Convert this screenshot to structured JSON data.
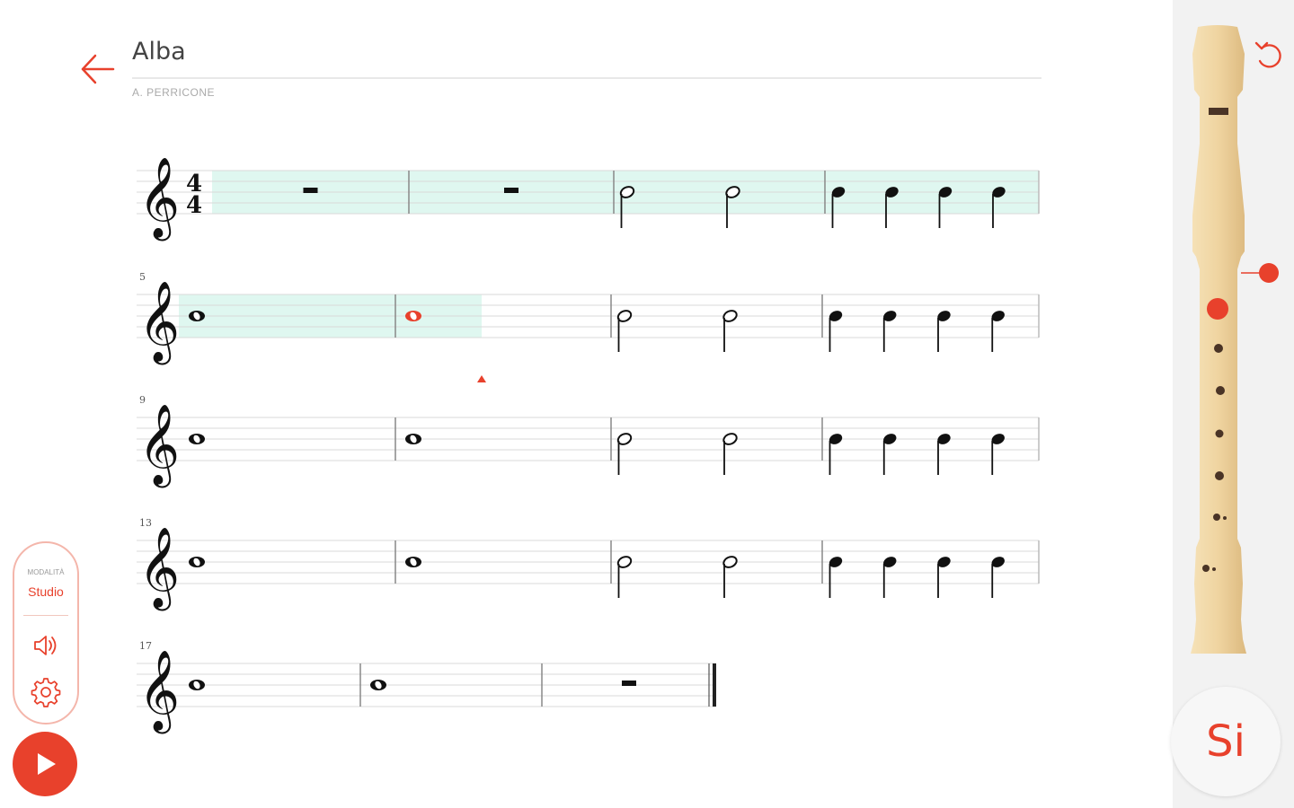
{
  "header": {
    "title": "Alba",
    "composer": "A. PERRICONE"
  },
  "score": {
    "time_signature": {
      "top": "4",
      "bottom": "4"
    },
    "rows": [
      {
        "number": "",
        "measures": [
          {
            "notes": [
              "rest-half"
            ]
          },
          {
            "notes": [
              "rest-half"
            ]
          },
          {
            "notes": [
              "half",
              "half"
            ]
          },
          {
            "notes": [
              "quarter",
              "quarter",
              "quarter",
              "quarter"
            ]
          }
        ]
      },
      {
        "number": "5",
        "measures": [
          {
            "notes": [
              "whole"
            ]
          },
          {
            "notes": [
              "whole-active"
            ]
          },
          {
            "notes": [
              "half",
              "half"
            ]
          },
          {
            "notes": [
              "quarter",
              "quarter",
              "quarter",
              "quarter"
            ]
          }
        ]
      },
      {
        "number": "9",
        "measures": [
          {
            "notes": [
              "whole"
            ]
          },
          {
            "notes": [
              "whole"
            ]
          },
          {
            "notes": [
              "half",
              "half"
            ]
          },
          {
            "notes": [
              "quarter",
              "quarter",
              "quarter",
              "quarter"
            ]
          }
        ]
      },
      {
        "number": "13",
        "measures": [
          {
            "notes": [
              "whole"
            ]
          },
          {
            "notes": [
              "whole"
            ]
          },
          {
            "notes": [
              "half",
              "half"
            ]
          },
          {
            "notes": [
              "quarter",
              "quarter",
              "quarter",
              "quarter"
            ]
          }
        ]
      },
      {
        "number": "17",
        "measures": [
          {
            "notes": [
              "whole"
            ]
          },
          {
            "notes": [
              "whole"
            ]
          },
          {
            "notes": [
              "rest-half"
            ]
          }
        ],
        "final": true
      }
    ],
    "progress": {
      "completed_measures": 5,
      "current_measure": 6,
      "current_measure_fraction": 0.4
    }
  },
  "controls": {
    "mode_caption": "MODALITÀ",
    "mode_value": "Studio",
    "sound_icon": "speaker-icon",
    "settings_icon": "gear-icon",
    "play_icon": "play-icon"
  },
  "recorder": {
    "current_note": "Si",
    "reset_icon": "reset-icon",
    "closed_holes": [
      "thumb"
    ]
  },
  "colors": {
    "accent": "#e8412c",
    "highlight": "#dff7f0",
    "wood": "#ecd09c"
  }
}
